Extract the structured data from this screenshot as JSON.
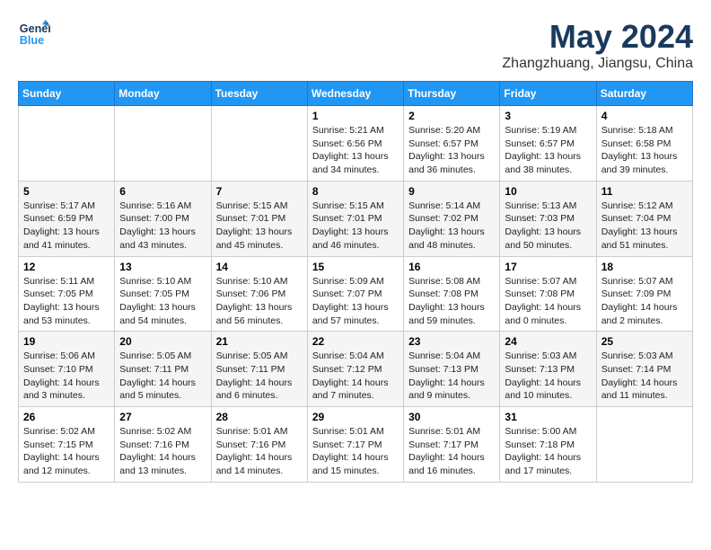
{
  "header": {
    "logo_line1": "General",
    "logo_line2": "Blue",
    "month_year": "May 2024",
    "location": "Zhangzhuang, Jiangsu, China"
  },
  "weekdays": [
    "Sunday",
    "Monday",
    "Tuesday",
    "Wednesday",
    "Thursday",
    "Friday",
    "Saturday"
  ],
  "weeks": [
    [
      {
        "day": "",
        "sunrise": "",
        "sunset": "",
        "daylight": ""
      },
      {
        "day": "",
        "sunrise": "",
        "sunset": "",
        "daylight": ""
      },
      {
        "day": "",
        "sunrise": "",
        "sunset": "",
        "daylight": ""
      },
      {
        "day": "1",
        "sunrise": "Sunrise: 5:21 AM",
        "sunset": "Sunset: 6:56 PM",
        "daylight": "Daylight: 13 hours and 34 minutes."
      },
      {
        "day": "2",
        "sunrise": "Sunrise: 5:20 AM",
        "sunset": "Sunset: 6:57 PM",
        "daylight": "Daylight: 13 hours and 36 minutes."
      },
      {
        "day": "3",
        "sunrise": "Sunrise: 5:19 AM",
        "sunset": "Sunset: 6:57 PM",
        "daylight": "Daylight: 13 hours and 38 minutes."
      },
      {
        "day": "4",
        "sunrise": "Sunrise: 5:18 AM",
        "sunset": "Sunset: 6:58 PM",
        "daylight": "Daylight: 13 hours and 39 minutes."
      }
    ],
    [
      {
        "day": "5",
        "sunrise": "Sunrise: 5:17 AM",
        "sunset": "Sunset: 6:59 PM",
        "daylight": "Daylight: 13 hours and 41 minutes."
      },
      {
        "day": "6",
        "sunrise": "Sunrise: 5:16 AM",
        "sunset": "Sunset: 7:00 PM",
        "daylight": "Daylight: 13 hours and 43 minutes."
      },
      {
        "day": "7",
        "sunrise": "Sunrise: 5:15 AM",
        "sunset": "Sunset: 7:01 PM",
        "daylight": "Daylight: 13 hours and 45 minutes."
      },
      {
        "day": "8",
        "sunrise": "Sunrise: 5:15 AM",
        "sunset": "Sunset: 7:01 PM",
        "daylight": "Daylight: 13 hours and 46 minutes."
      },
      {
        "day": "9",
        "sunrise": "Sunrise: 5:14 AM",
        "sunset": "Sunset: 7:02 PM",
        "daylight": "Daylight: 13 hours and 48 minutes."
      },
      {
        "day": "10",
        "sunrise": "Sunrise: 5:13 AM",
        "sunset": "Sunset: 7:03 PM",
        "daylight": "Daylight: 13 hours and 50 minutes."
      },
      {
        "day": "11",
        "sunrise": "Sunrise: 5:12 AM",
        "sunset": "Sunset: 7:04 PM",
        "daylight": "Daylight: 13 hours and 51 minutes."
      }
    ],
    [
      {
        "day": "12",
        "sunrise": "Sunrise: 5:11 AM",
        "sunset": "Sunset: 7:05 PM",
        "daylight": "Daylight: 13 hours and 53 minutes."
      },
      {
        "day": "13",
        "sunrise": "Sunrise: 5:10 AM",
        "sunset": "Sunset: 7:05 PM",
        "daylight": "Daylight: 13 hours and 54 minutes."
      },
      {
        "day": "14",
        "sunrise": "Sunrise: 5:10 AM",
        "sunset": "Sunset: 7:06 PM",
        "daylight": "Daylight: 13 hours and 56 minutes."
      },
      {
        "day": "15",
        "sunrise": "Sunrise: 5:09 AM",
        "sunset": "Sunset: 7:07 PM",
        "daylight": "Daylight: 13 hours and 57 minutes."
      },
      {
        "day": "16",
        "sunrise": "Sunrise: 5:08 AM",
        "sunset": "Sunset: 7:08 PM",
        "daylight": "Daylight: 13 hours and 59 minutes."
      },
      {
        "day": "17",
        "sunrise": "Sunrise: 5:07 AM",
        "sunset": "Sunset: 7:08 PM",
        "daylight": "Daylight: 14 hours and 0 minutes."
      },
      {
        "day": "18",
        "sunrise": "Sunrise: 5:07 AM",
        "sunset": "Sunset: 7:09 PM",
        "daylight": "Daylight: 14 hours and 2 minutes."
      }
    ],
    [
      {
        "day": "19",
        "sunrise": "Sunrise: 5:06 AM",
        "sunset": "Sunset: 7:10 PM",
        "daylight": "Daylight: 14 hours and 3 minutes."
      },
      {
        "day": "20",
        "sunrise": "Sunrise: 5:05 AM",
        "sunset": "Sunset: 7:11 PM",
        "daylight": "Daylight: 14 hours and 5 minutes."
      },
      {
        "day": "21",
        "sunrise": "Sunrise: 5:05 AM",
        "sunset": "Sunset: 7:11 PM",
        "daylight": "Daylight: 14 hours and 6 minutes."
      },
      {
        "day": "22",
        "sunrise": "Sunrise: 5:04 AM",
        "sunset": "Sunset: 7:12 PM",
        "daylight": "Daylight: 14 hours and 7 minutes."
      },
      {
        "day": "23",
        "sunrise": "Sunrise: 5:04 AM",
        "sunset": "Sunset: 7:13 PM",
        "daylight": "Daylight: 14 hours and 9 minutes."
      },
      {
        "day": "24",
        "sunrise": "Sunrise: 5:03 AM",
        "sunset": "Sunset: 7:13 PM",
        "daylight": "Daylight: 14 hours and 10 minutes."
      },
      {
        "day": "25",
        "sunrise": "Sunrise: 5:03 AM",
        "sunset": "Sunset: 7:14 PM",
        "daylight": "Daylight: 14 hours and 11 minutes."
      }
    ],
    [
      {
        "day": "26",
        "sunrise": "Sunrise: 5:02 AM",
        "sunset": "Sunset: 7:15 PM",
        "daylight": "Daylight: 14 hours and 12 minutes."
      },
      {
        "day": "27",
        "sunrise": "Sunrise: 5:02 AM",
        "sunset": "Sunset: 7:16 PM",
        "daylight": "Daylight: 14 hours and 13 minutes."
      },
      {
        "day": "28",
        "sunrise": "Sunrise: 5:01 AM",
        "sunset": "Sunset: 7:16 PM",
        "daylight": "Daylight: 14 hours and 14 minutes."
      },
      {
        "day": "29",
        "sunrise": "Sunrise: 5:01 AM",
        "sunset": "Sunset: 7:17 PM",
        "daylight": "Daylight: 14 hours and 15 minutes."
      },
      {
        "day": "30",
        "sunrise": "Sunrise: 5:01 AM",
        "sunset": "Sunset: 7:17 PM",
        "daylight": "Daylight: 14 hours and 16 minutes."
      },
      {
        "day": "31",
        "sunrise": "Sunrise: 5:00 AM",
        "sunset": "Sunset: 7:18 PM",
        "daylight": "Daylight: 14 hours and 17 minutes."
      },
      {
        "day": "",
        "sunrise": "",
        "sunset": "",
        "daylight": ""
      }
    ]
  ]
}
